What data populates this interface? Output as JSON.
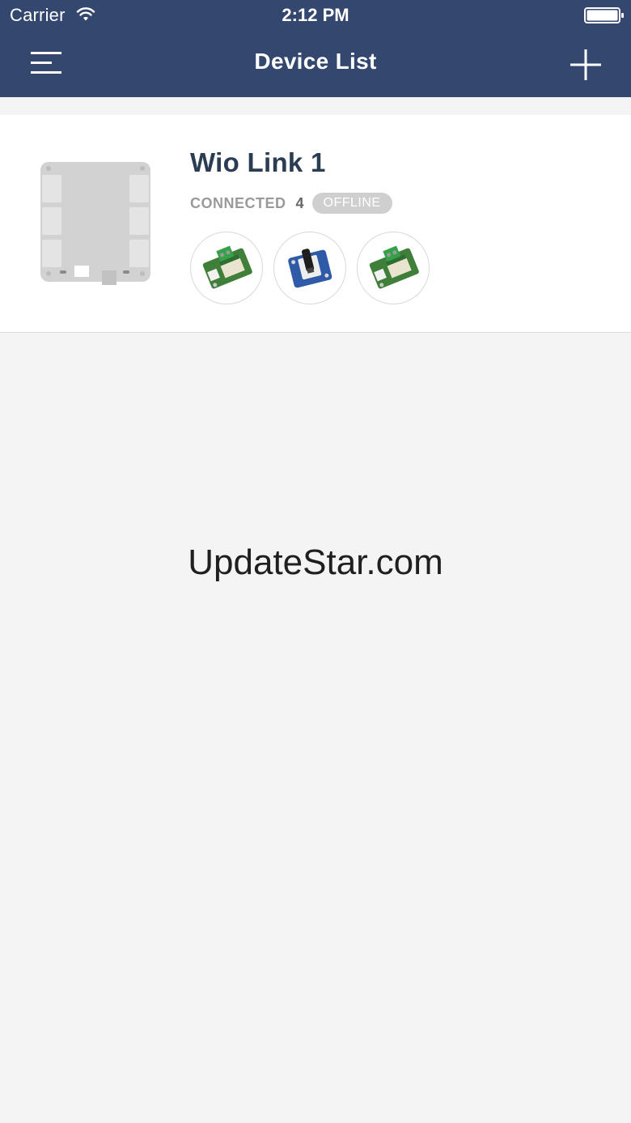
{
  "status_bar": {
    "carrier": "Carrier",
    "time": "2:12 PM",
    "wifi_icon": "wifi-icon",
    "battery_icon": "battery-icon"
  },
  "nav": {
    "title": "Device List",
    "menu_icon": "hamburger-menu-icon",
    "add_icon": "plus-icon"
  },
  "devices": [
    {
      "name": "Wio Link 1",
      "connected_label": "CONNECTED",
      "connected_count": "4",
      "status_badge": "OFFLINE",
      "board_icon": "wio-link-board-icon",
      "modules": [
        {
          "icon": "relay-module-icon"
        },
        {
          "icon": "button-module-icon"
        },
        {
          "icon": "relay-module-icon"
        }
      ]
    }
  ],
  "watermark": "UpdateStar.com",
  "colors": {
    "nav_background": "#34476f",
    "page_background": "#f4f4f4",
    "device_name": "#2b3d52",
    "badge_background": "#cfcfcf",
    "module_pcb_green": "#3f7f3a",
    "module_pcb_blue": "#2f5aa8"
  }
}
